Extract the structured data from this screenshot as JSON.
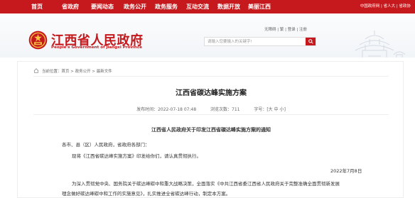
{
  "nav": [
    "首页",
    "省政府",
    "要闻动态",
    "政务公开",
    "政务服务",
    "互动交流",
    "数据开放",
    "美丽江西"
  ],
  "top_links": "中国政府网 | 省人大 | 省政协",
  "header": {
    "site_title": "江西省人民政府",
    "site_subtitle": "People's Government of Jiangxi Province",
    "access": "无障碍 | 繁 | 登录 | 注册",
    "search_placeholder": "请输入您要输入的关键字!"
  },
  "breadcrumb": "当前位置：首页 > 政务公开 > 最新文件",
  "article": {
    "title": "江西省碳达峰实施方案",
    "publish_date": "发布时间：2022-07-18 07:48",
    "views_label": "浏览次数：",
    "views": "711",
    "font_size_label": "字号：",
    "font_large": "大",
    "font_medium": "中",
    "font_small": "小",
    "font_open": "[",
    "font_close": "]",
    "notice_title": "江西省人民政府关于印发江西省碳达峰实施方案的通知",
    "p1": "各市、县（区）人民政府，省政府各部门：",
    "p2": "现将《江西省碳达峰实施方案》印发给你们，请认真贯彻执行。",
    "date": "2022年7月8日",
    "p3": "为深入贯彻党中央、国务院关于碳达峰碳中和重大战略决策，全面落实《中共江西省委江西省人民政府关于完整准确全面贯彻新发展",
    "p4": "理念做好碳达峰碳中和工作的实施意见》，扎实推进全省碳达峰行动，制定本方案。"
  },
  "colors": {
    "brand_red": "#c5191d",
    "text": "#333333",
    "muted": "#666666"
  }
}
